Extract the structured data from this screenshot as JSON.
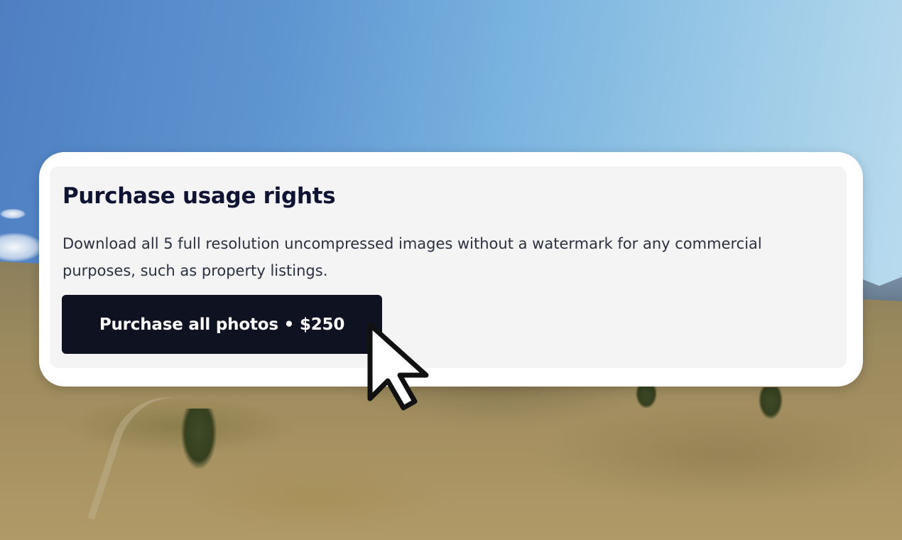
{
  "card": {
    "title": "Purchase usage rights",
    "description": "Download all 5 full resolution uncompressed images without a watermark for any commercial purposes, such as property listings.",
    "button_label": "Purchase all photos • $250"
  },
  "background": {
    "scene": "landscape-photo",
    "sky_color": "#6fa8da",
    "ground_color": "#9f8c5f"
  },
  "cursor": {
    "icon": "pointer-arrow-icon"
  },
  "colors": {
    "button_bg": "#0e1221",
    "title_text": "#101433",
    "panel_bg": "#f4f4f5"
  }
}
